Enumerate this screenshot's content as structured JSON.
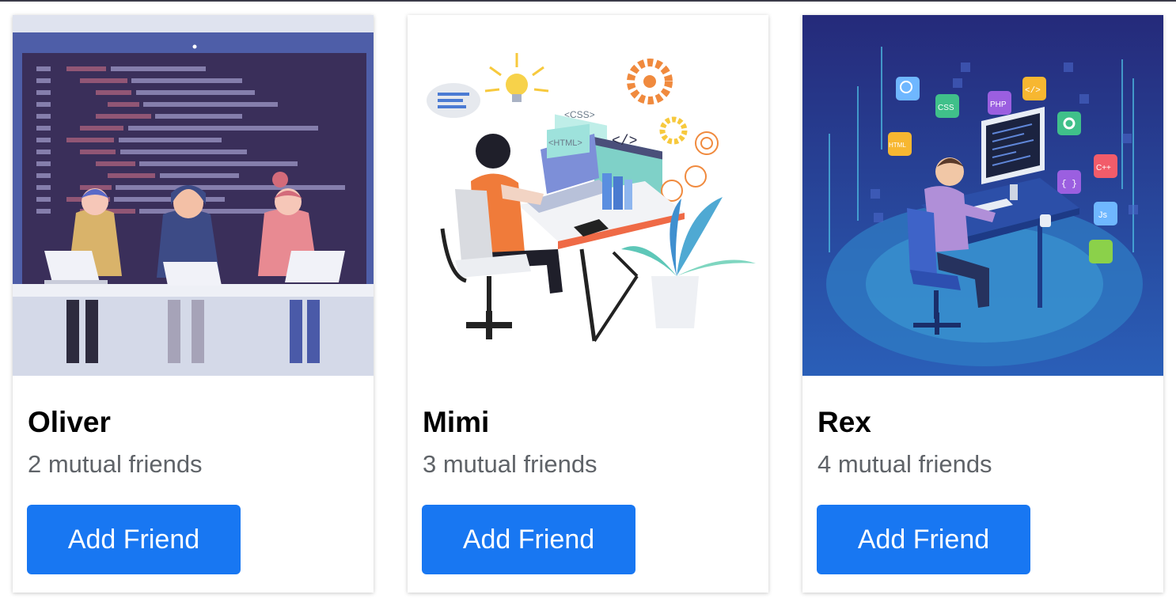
{
  "cards": [
    {
      "name": "Oliver",
      "mutual": "2 mutual friends",
      "button": "Add Friend",
      "illustration": "three-developers-laptops"
    },
    {
      "name": "Mimi",
      "mutual": "3 mutual friends",
      "button": "Add Friend",
      "illustration": "developer-at-desk-isometric",
      "illustration_labels": {
        "css": "<CSS>",
        "html": "<HTML>",
        "code": "</>"
      }
    },
    {
      "name": "Rex",
      "mutual": "4 mutual friends",
      "button": "Add Friend",
      "illustration": "developer-tech-icons",
      "illustration_labels": {
        "css": "CSS",
        "php": "PHP",
        "html": "HTML",
        "cpp": "C++",
        "js": "Js",
        "code": "</>",
        "braces": "{ }"
      }
    }
  ],
  "colors": {
    "button": "#1877f2",
    "mutual_text": "#5f6368"
  }
}
